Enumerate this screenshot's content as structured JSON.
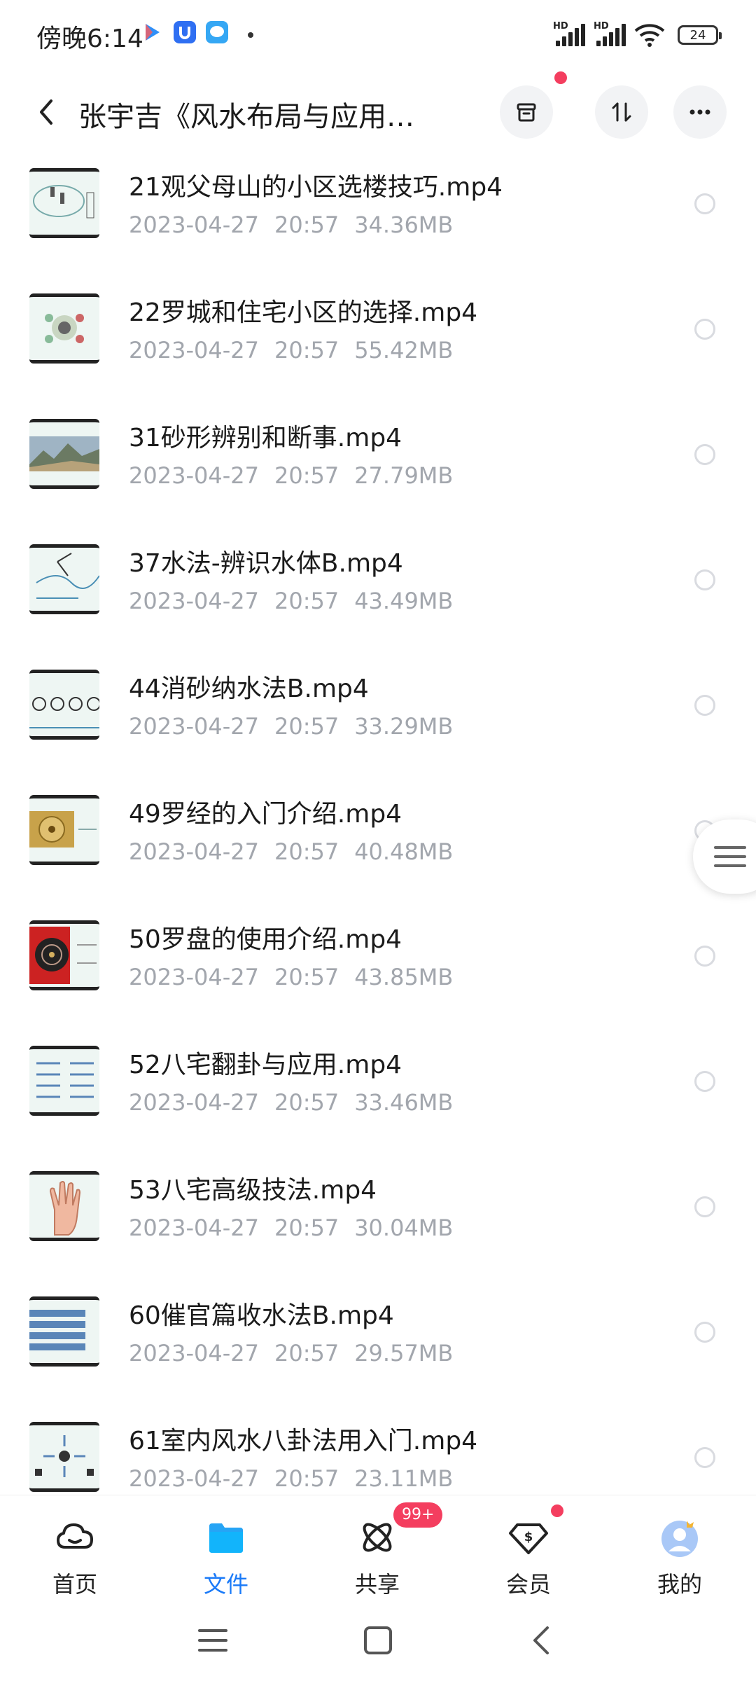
{
  "status_bar": {
    "time": "傍晚6:14",
    "hd1": "HD",
    "hd2": "HD",
    "battery": "24"
  },
  "header": {
    "title": "张宇吉《风水布局与应用…"
  },
  "files": [
    {
      "name": "21观父母山的小区选楼技巧.mp4",
      "date": "2023-04-27",
      "time": "20:57",
      "size": "34.36MB"
    },
    {
      "name": "22罗城和住宅小区的选择.mp4",
      "date": "2023-04-27",
      "time": "20:57",
      "size": "55.42MB"
    },
    {
      "name": "31砂形辨别和断事.mp4",
      "date": "2023-04-27",
      "time": "20:57",
      "size": "27.79MB"
    },
    {
      "name": "37水法-辨识水体B.mp4",
      "date": "2023-04-27",
      "time": "20:57",
      "size": "43.49MB"
    },
    {
      "name": "44消砂纳水法B.mp4",
      "date": "2023-04-27",
      "time": "20:57",
      "size": "33.29MB"
    },
    {
      "name": "49罗经的入门介绍.mp4",
      "date": "2023-04-27",
      "time": "20:57",
      "size": "40.48MB"
    },
    {
      "name": "50罗盘的使用介绍.mp4",
      "date": "2023-04-27",
      "time": "20:57",
      "size": "43.85MB"
    },
    {
      "name": "52八宅翻卦与应用.mp4",
      "date": "2023-04-27",
      "time": "20:57",
      "size": "33.46MB"
    },
    {
      "name": "53八宅高级技法.mp4",
      "date": "2023-04-27",
      "time": "20:57",
      "size": "30.04MB"
    },
    {
      "name": "60催官篇收水法B.mp4",
      "date": "2023-04-27",
      "time": "20:57",
      "size": "29.57MB"
    },
    {
      "name": "61室内风水八卦法用入门.mp4",
      "date": "2023-04-27",
      "time": "20:57",
      "size": "23.11MB"
    }
  ],
  "bottom_nav": {
    "home": "首页",
    "files": "文件",
    "share": "共享",
    "member": "会员",
    "me": "我的",
    "share_badge": "99+"
  },
  "colors": {
    "accent": "#1a7af8",
    "badge": "#f43e5f",
    "meta_text": "#a2a6ad"
  }
}
